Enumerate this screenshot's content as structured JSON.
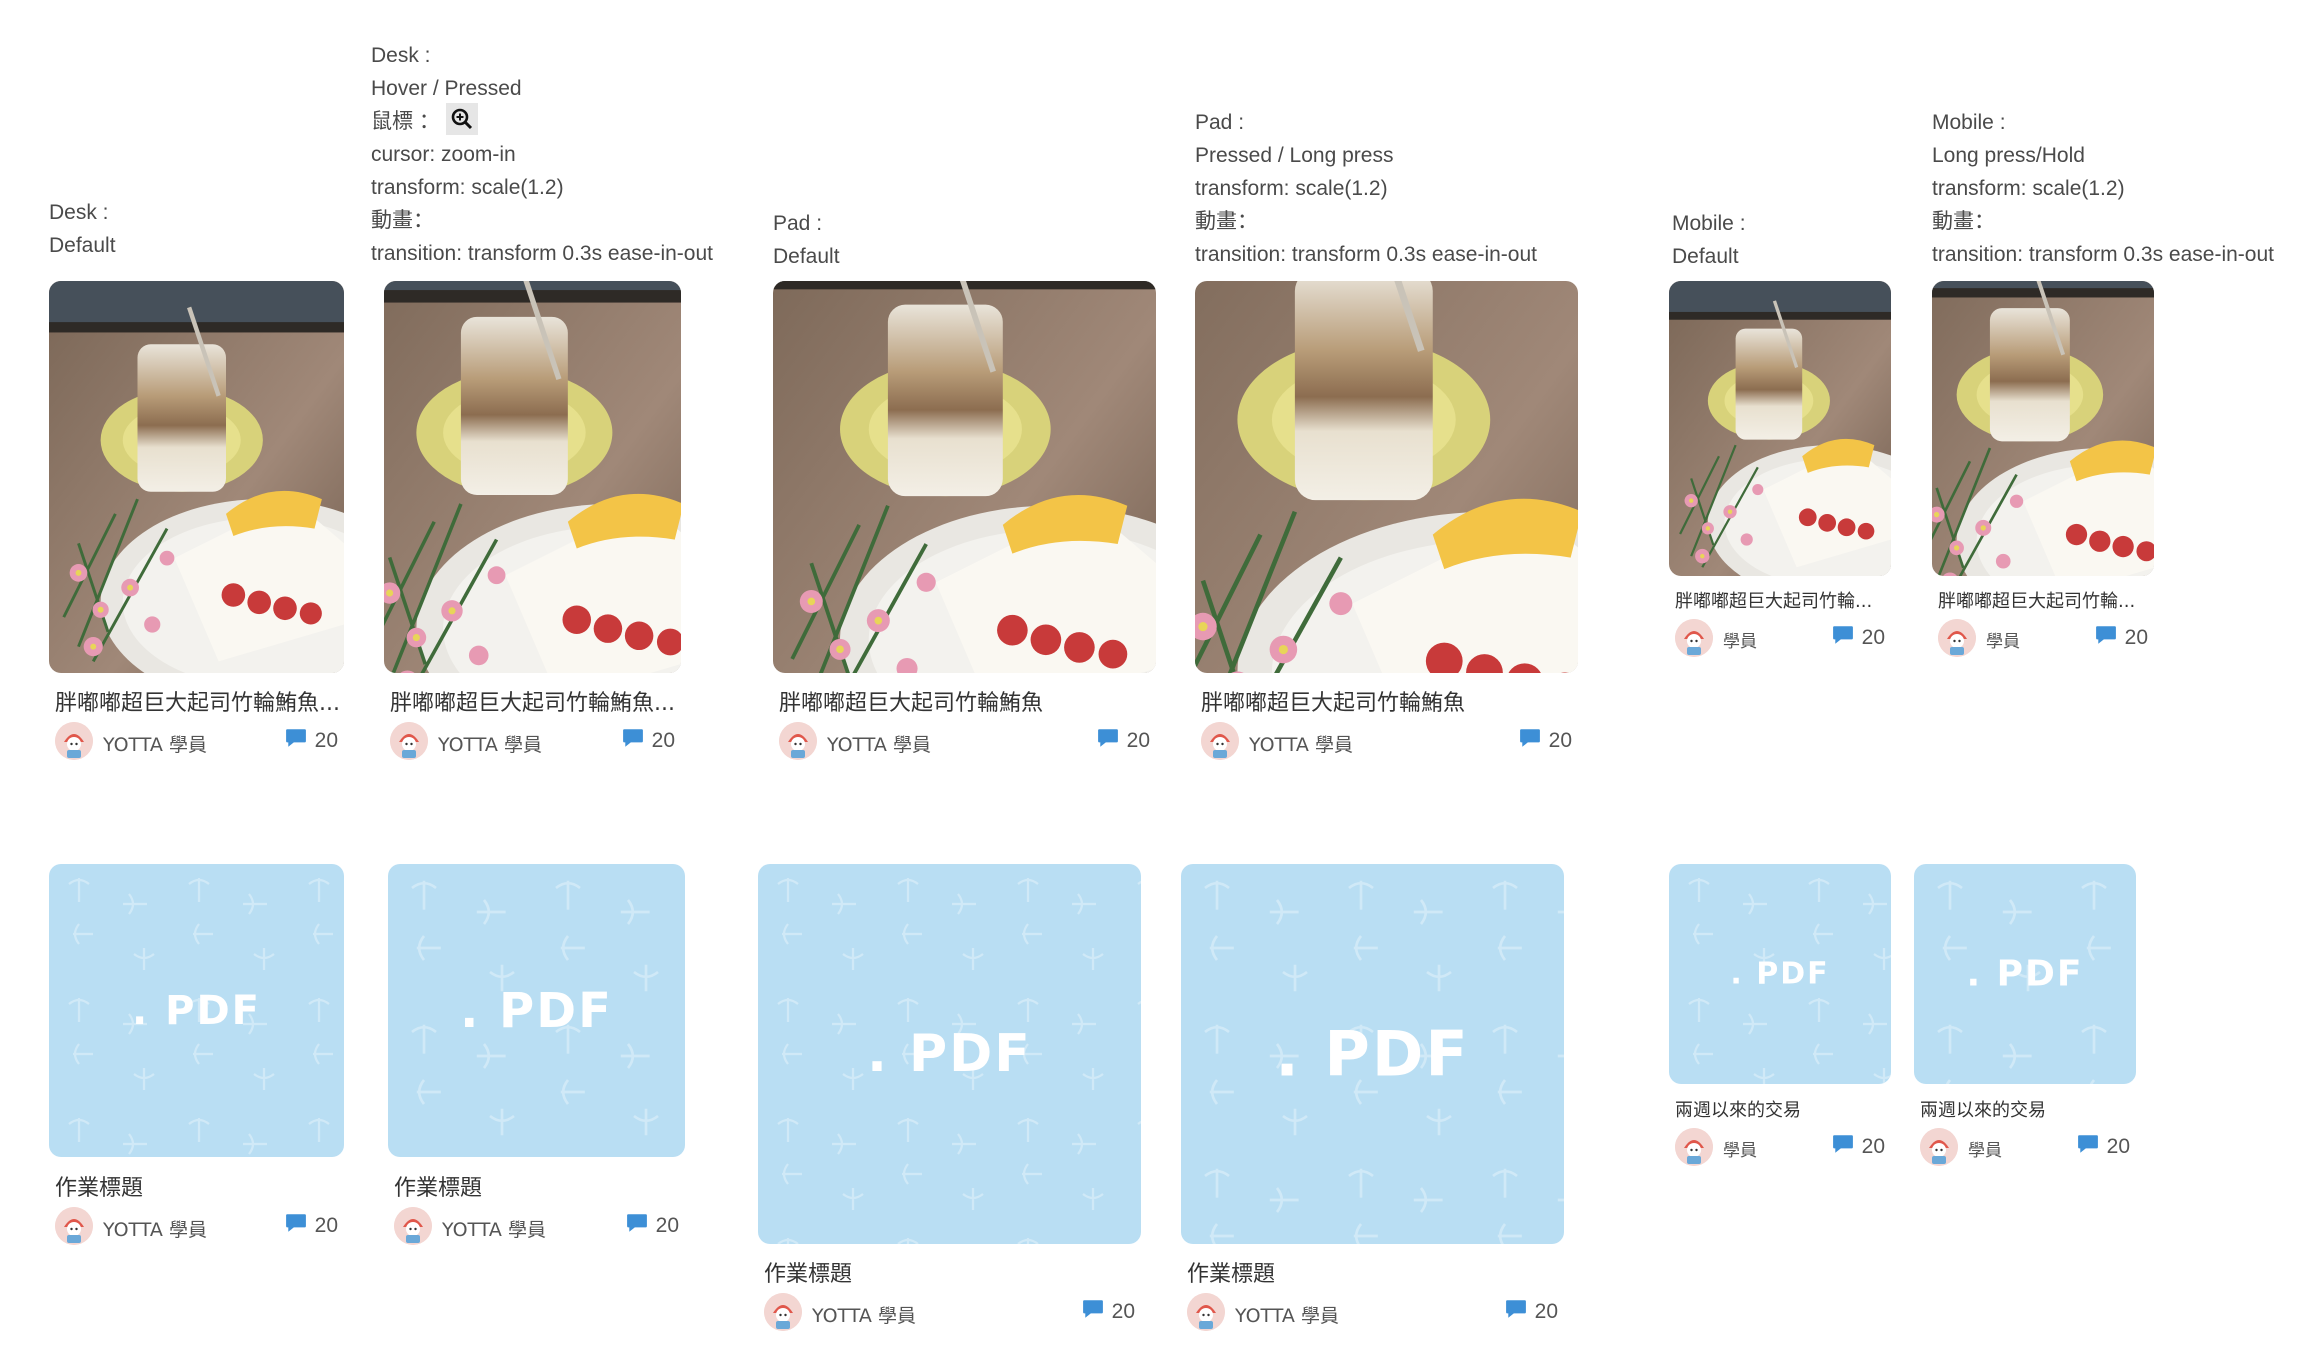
{
  "annotations": {
    "desk_default": {
      "line1": "Desk :",
      "line2": "Default"
    },
    "desk_hover": {
      "line1": "Desk :",
      "line2": "Hover / Pressed",
      "line3": "鼠標 ：",
      "line4": "cursor: zoom-in",
      "line5": "transform: scale(1.2)",
      "line6": "動畫：",
      "line7": "transition: transform 0.3s ease-in-out"
    },
    "pad_default": {
      "line1": "Pad :",
      "line2": "Default"
    },
    "pad_pressed": {
      "line1": "Pad :",
      "line2": "Pressed / Long press",
      "line3": "transform: scale(1.2)",
      "line4": "動畫：",
      "line5": "transition: transform 0.3s ease-in-out"
    },
    "mobile_default": {
      "line1": "Mobile :",
      "line2": "Default"
    },
    "mobile_hold": {
      "line1": "Mobile :",
      "line2": "Long press/Hold",
      "line3": "transform: scale(1.2)",
      "line4": "動畫：",
      "line5": "transition: transform 0.3s ease-in-out"
    }
  },
  "photo_cards": {
    "desk_default": {
      "title": "胖嘟嘟超巨大起司竹輪鮪魚...",
      "author": "YOTTA 學員",
      "comments": "20"
    },
    "desk_hover": {
      "title": "胖嘟嘟超巨大起司竹輪鮪魚...",
      "author": "YOTTA 學員",
      "comments": "20"
    },
    "pad_default": {
      "title": "胖嘟嘟超巨大起司竹輪鮪魚",
      "author": "YOTTA 學員",
      "comments": "20"
    },
    "pad_pressed": {
      "title": "胖嘟嘟超巨大起司竹輪鮪魚",
      "author": "YOTTA 學員",
      "comments": "20"
    },
    "mobile_default": {
      "title": "胖嘟嘟超巨大起司竹輪...",
      "author": "學員",
      "comments": "20"
    },
    "mobile_hold": {
      "title": "胖嘟嘟超巨大起司竹輪...",
      "author": "學員",
      "comments": "20"
    }
  },
  "pdf_cards": {
    "desk_default": {
      "label": ". PDF",
      "title": "作業標題",
      "author": "YOTTA 學員",
      "comments": "20"
    },
    "desk_hover": {
      "label": ". PDF",
      "title": "作業標題",
      "author": "YOTTA 學員",
      "comments": "20"
    },
    "pad_default": {
      "label": ". PDF",
      "title": "作業標題",
      "author": "YOTTA 學員",
      "comments": "20"
    },
    "pad_pressed": {
      "label": ". PDF",
      "title": "作業標題",
      "author": "YOTTA 學員",
      "comments": "20"
    },
    "mobile_default": {
      "label": ". PDF",
      "title": "兩週以來的交易",
      "author": "學員",
      "comments": "20"
    },
    "mobile_hold": {
      "label": ". PDF",
      "title": "兩週以來的交易",
      "author": "學員",
      "comments": "20"
    }
  },
  "icons": {
    "zoom": "zoom-in-icon",
    "comment": "comment-bubble-icon",
    "avatar": "avatar-icon"
  },
  "colors": {
    "pdf_background": "#b9def3",
    "comment_icon": "#3d8fd6",
    "text": "#333333",
    "annotation": "#4a4a4a"
  }
}
